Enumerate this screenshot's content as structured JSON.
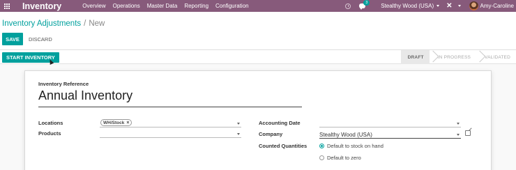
{
  "navbar": {
    "app_title": "Inventory",
    "menu": [
      "Overview",
      "Operations",
      "Master Data",
      "Reporting",
      "Configuration"
    ],
    "chat_badge": "3",
    "company": "Stealthy Wood (USA)",
    "user": "Amy-Caroline",
    "color": "#875a7b"
  },
  "breadcrumb": {
    "parent": "Inventory Adjustments",
    "separator": "/",
    "current": "New"
  },
  "buttons": {
    "save": "SAVE",
    "discard": "DISCARD",
    "start_inventory": "START INVENTORY"
  },
  "status": {
    "stages": [
      "DRAFT",
      "IN PROGRESS",
      "VALIDATED"
    ],
    "active": "DRAFT"
  },
  "form": {
    "reference_label": "Inventory Reference",
    "reference_value": "Annual Inventory",
    "locations_label": "Locations",
    "locations_tag": "WH/Stock",
    "products_label": "Products",
    "accounting_date_label": "Accounting Date",
    "company_label": "Company",
    "company_value": "Stealthy Wood (USA)",
    "counted_label": "Counted Quantities",
    "counted_options": [
      "Default to stock on hand",
      "Default to zero"
    ],
    "counted_selected": "Default to stock on hand"
  },
  "accent_color": "#00a09d"
}
